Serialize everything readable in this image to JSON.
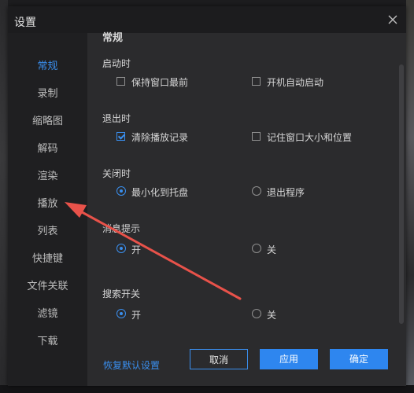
{
  "window": {
    "title": "设置"
  },
  "sidebar": {
    "items": [
      {
        "label": "常规",
        "active": true
      },
      {
        "label": "录制"
      },
      {
        "label": "缩略图"
      },
      {
        "label": "解码"
      },
      {
        "label": "渲染"
      },
      {
        "label": "播放"
      },
      {
        "label": "列表"
      },
      {
        "label": "快捷键"
      },
      {
        "label": "文件关联"
      },
      {
        "label": "滤镜"
      },
      {
        "label": "下载"
      }
    ]
  },
  "content": {
    "header_clipped": "常规",
    "startup": {
      "label": "启动时",
      "keep_on_top": {
        "label": "保持窗口最前",
        "checked": false
      },
      "auto_start": {
        "label": "开机自动启动",
        "checked": false
      }
    },
    "exit": {
      "label": "退出时",
      "clear_history": {
        "label": "清除播放记录",
        "checked": true
      },
      "remember_window": {
        "label": "记住窗口大小和位置",
        "checked": false
      }
    },
    "close": {
      "label": "关闭时",
      "minimize_tray": {
        "label": "最小化到托盘",
        "selected": true
      },
      "exit_program": {
        "label": "退出程序",
        "selected": false
      }
    },
    "message_tip": {
      "label": "消息提示",
      "on": {
        "label": "开",
        "selected": true
      },
      "off": {
        "label": "关",
        "selected": false
      }
    },
    "search_switch": {
      "label": "搜索开关",
      "on": {
        "label": "开",
        "selected": true
      },
      "off": {
        "label": "关",
        "selected": false
      }
    }
  },
  "footer": {
    "restore_defaults": "恢复默认设置",
    "cancel": "取消",
    "apply": "应用",
    "ok": "确定"
  },
  "colors": {
    "accent": "#3a8fef",
    "annotation_arrow": "#e8524a",
    "dialog_bg": "#2b2b2d",
    "sidebar_bg": "#1f1f21"
  }
}
